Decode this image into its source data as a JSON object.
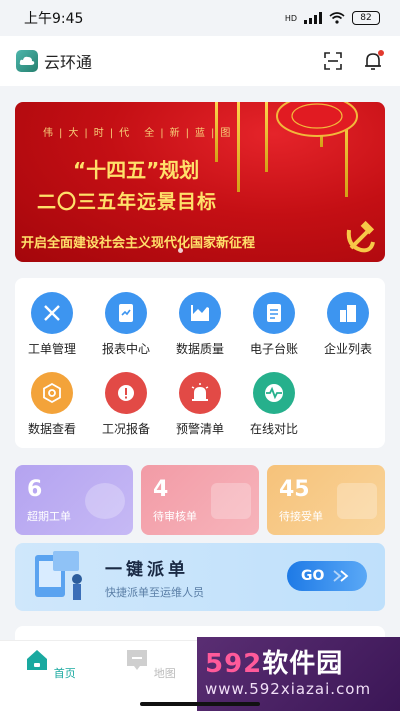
{
  "status_bar": {
    "time": "上午9:45",
    "battery": "82",
    "hd_label": "HD"
  },
  "header": {
    "title": "云环通",
    "logo_text": "云环通"
  },
  "banner": {
    "slogan": "伟|大|时|代 全|新|蓝|图",
    "line1": "“十四五”规划",
    "line2": "二〇三五年远景目标",
    "line3": "开启全面建设社会主义现代化国家新征程"
  },
  "menu": {
    "items": [
      {
        "label": "工单管理",
        "icon": "tools-icon",
        "color": "#3d95f0"
      },
      {
        "label": "报表中心",
        "icon": "report-icon",
        "color": "#3d95f0"
      },
      {
        "label": "数据质量",
        "icon": "chart-icon",
        "color": "#3d95f0"
      },
      {
        "label": "电子台账",
        "icon": "ledger-icon",
        "color": "#3d95f0"
      },
      {
        "label": "企业列表",
        "icon": "building-icon",
        "color": "#3d95f0"
      },
      {
        "label": "数据查看",
        "icon": "data-view-icon",
        "color": "#f3a33a"
      },
      {
        "label": "工况报备",
        "icon": "alert-icon",
        "color": "#e24a46"
      },
      {
        "label": "预警清单",
        "icon": "siren-icon",
        "color": "#e24a46"
      },
      {
        "label": "在线对比",
        "icon": "pulse-icon",
        "color": "#26b08c"
      }
    ]
  },
  "stats": [
    {
      "value": "6",
      "label": "超期工单",
      "color": "#b6a5f0"
    },
    {
      "value": "4",
      "label": "待审核单",
      "color": "#f4a3ab"
    },
    {
      "value": "45",
      "label": "待接受单",
      "color": "#f7c984"
    }
  ],
  "dispatch": {
    "title": "一键派单",
    "subtitle": "快捷派单至运维人员",
    "go_label": "GO"
  },
  "tabs": [
    {
      "label": "首页",
      "active": true
    },
    {
      "label": "地图",
      "active": false
    }
  ],
  "watermark": {
    "line1_num": "592",
    "line1_text": "软件园",
    "line2": "www.592xiazai.com"
  },
  "colors": {
    "accent": "#3d95f0",
    "tab_active": "#1aa9a0"
  }
}
